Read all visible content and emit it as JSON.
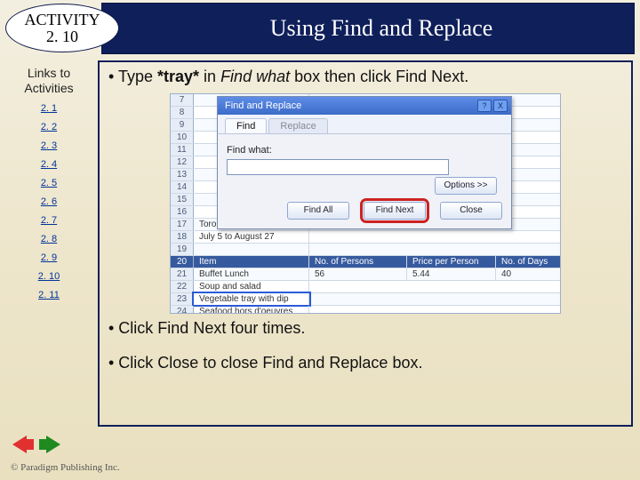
{
  "header": {
    "activity_label": "ACTIVITY",
    "activity_num": "2. 10",
    "title": "Using Find and Replace"
  },
  "sidebar": {
    "title_line1": "Links to",
    "title_line2": "Activities",
    "items": [
      {
        "label": "2. 1"
      },
      {
        "label": "2. 2"
      },
      {
        "label": "2. 3"
      },
      {
        "label": "2. 4"
      },
      {
        "label": "2. 5"
      },
      {
        "label": "2. 6"
      },
      {
        "label": "2. 7"
      },
      {
        "label": "2. 8"
      },
      {
        "label": "2. 9"
      },
      {
        "label": "2. 10"
      },
      {
        "label": "2. 11"
      }
    ]
  },
  "content": {
    "bullet1_prefix": "• Type ",
    "bullet1_bold": "*tray*",
    "bullet1_mid": " in ",
    "bullet1_italic": "Find what",
    "bullet1_suffix": " box then click Find Next.",
    "bullet2": "• Click Find Next four times.",
    "bullet3": "• Click Close to close Find and Replace box."
  },
  "dialog": {
    "title": "Find and Replace",
    "help": "?",
    "close_x": "X",
    "tab_find": "Find",
    "tab_replace": "Replace",
    "findwhat_label": "Find what:",
    "options_btn": "Options >>",
    "btn_findall": "Find All",
    "btn_findnext": "Find Next",
    "btn_close": "Close"
  },
  "sheet": {
    "rows": [
      {
        "n": "7",
        "a": ""
      },
      {
        "n": "8",
        "a": ""
      },
      {
        "n": "9",
        "a": ""
      },
      {
        "n": "10",
        "a": ""
      },
      {
        "n": "11",
        "a": ""
      },
      {
        "n": "12",
        "a": ""
      },
      {
        "n": "13",
        "a": ""
      },
      {
        "n": "14",
        "a": ""
      },
      {
        "n": "15",
        "a": ""
      },
      {
        "n": "16",
        "a": ""
      },
      {
        "n": "17",
        "a": "Toronto Location Filming"
      },
      {
        "n": "18",
        "a": "July 5 to August 27"
      },
      {
        "n": "19",
        "a": ""
      }
    ],
    "header_row": {
      "n": "20",
      "a": "Item",
      "b": "No. of Persons",
      "c": "Price per Person",
      "d": "No. of Days"
    },
    "data_rows": [
      {
        "n": "21",
        "a": "Buffet Lunch",
        "b": "56",
        "c": "5.44",
        "d": "40"
      },
      {
        "n": "22",
        "a": "Soup and salad",
        "b": "",
        "c": "",
        "d": ""
      },
      {
        "n": "23",
        "a": "Vegetable tray with dip",
        "b": "",
        "c": "",
        "d": ""
      },
      {
        "n": "24",
        "a": "Seafood hors d'oeuvres",
        "b": "",
        "c": "",
        "d": ""
      }
    ]
  },
  "footer": {
    "copyright": "© Paradigm Publishing Inc."
  }
}
